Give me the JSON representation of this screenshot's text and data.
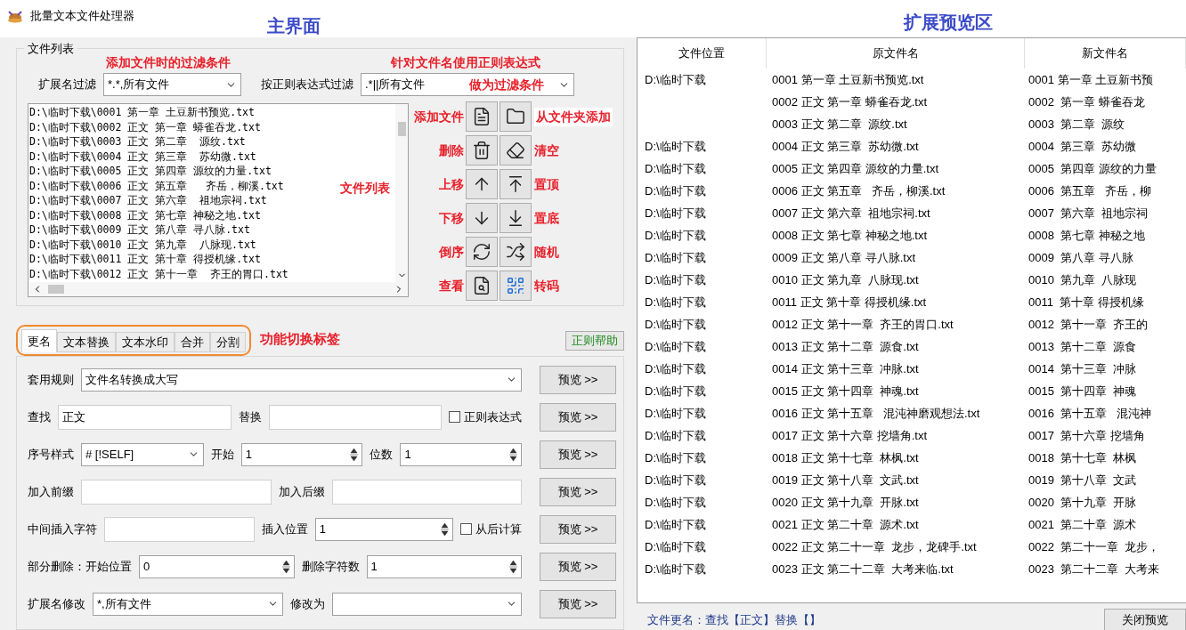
{
  "window": {
    "title": "批量文本文件处理器"
  },
  "annotations": {
    "main": "主界面",
    "preview": "扩展预览区",
    "ext_note": "添加文件时的过滤条件",
    "regex_note": "针对文件名使用正则表达式",
    "regex_note_2": "做为过滤条件",
    "list_note": "文件列表",
    "tabs_note": "功能切换标签"
  },
  "file_group": {
    "title": "文件列表",
    "ext_filter": {
      "label": "扩展名过滤",
      "value": "*.*,所有文件"
    },
    "regex_filter": {
      "label": "按正则表达式过滤",
      "value": ".*||所有文件"
    },
    "files": [
      "D:\\临时下载\\0001 第一章 土豆新书预览.txt",
      "D:\\临时下载\\0002 正文 第一章 蟒雀吞龙.txt",
      "D:\\临时下载\\0003 正文 第二章  源纹.txt",
      "D:\\临时下载\\0004 正文 第三章  苏幼微.txt",
      "D:\\临时下载\\0005 正文 第四章 源纹的力量.txt",
      "D:\\临时下载\\0006 正文 第五章   齐岳，柳溪.txt",
      "D:\\临时下载\\0007 正文 第六章  祖地宗祠.txt",
      "D:\\临时下载\\0008 正文 第七章 神秘之地.txt",
      "D:\\临时下载\\0009 正文 第八章 寻八脉.txt",
      "D:\\临时下载\\0010 正文 第九章  八脉现.txt",
      "D:\\临时下载\\0011 正文 第十章 得授机缘.txt",
      "D:\\临时下载\\0012 正文 第十一章  齐王的胃口.txt"
    ],
    "tool_rows": [
      {
        "left_note": "添加文件",
        "right_note": "从文件夹添加"
      },
      {
        "left_note": "删除",
        "right_note": "清空"
      },
      {
        "left_note": "上移",
        "right_note": "置顶"
      },
      {
        "left_note": "下移",
        "right_note": "置底"
      },
      {
        "left_note": "倒序",
        "right_note": "随机"
      },
      {
        "left_note": "查看",
        "right_note": "转码"
      }
    ]
  },
  "tabs": [
    {
      "label": "更名",
      "selected": true
    },
    {
      "label": "文本替换",
      "selected": false
    },
    {
      "label": "文本水印",
      "selected": false
    },
    {
      "label": "合并",
      "selected": false
    },
    {
      "label": "分割",
      "selected": false
    }
  ],
  "help_button": "正则帮助",
  "form_rows": [
    {
      "fields": [
        {
          "kind": "label",
          "text": "套用规则"
        },
        {
          "kind": "combo",
          "value": "文件名转换成大写"
        }
      ],
      "button": "预览 >>"
    },
    {
      "fields": [
        {
          "kind": "label",
          "text": "查找"
        },
        {
          "kind": "text",
          "value": "正文"
        },
        {
          "kind": "label",
          "text": "替换"
        },
        {
          "kind": "text"
        },
        {
          "kind": "check",
          "text": "正则表达式",
          "checked": false
        }
      ],
      "button": "预览 >>"
    },
    {
      "fields": [
        {
          "kind": "label",
          "text": "序号样式"
        },
        {
          "kind": "combo",
          "value": "# [!SELF]"
        },
        {
          "kind": "label",
          "text": "开始"
        },
        {
          "kind": "spin",
          "value": "1"
        },
        {
          "kind": "label",
          "text": "位数"
        },
        {
          "kind": "spin",
          "value": "1"
        }
      ],
      "button": "预览 >>"
    },
    {
      "fields": [
        {
          "kind": "label",
          "text": "加入前缀"
        },
        {
          "kind": "text"
        },
        {
          "kind": "label",
          "text": "加入后缀"
        },
        {
          "kind": "text"
        }
      ],
      "button": "预览 >>"
    },
    {
      "fields": [
        {
          "kind": "label",
          "text": "中间插入字符"
        },
        {
          "kind": "text"
        },
        {
          "kind": "label",
          "text": "插入位置"
        },
        {
          "kind": "spin",
          "value": "1"
        },
        {
          "kind": "check",
          "text": "从后计算",
          "checked": false
        }
      ],
      "button": "预览 >>"
    },
    {
      "fields": [
        {
          "kind": "label",
          "text": "部分删除：开始位置"
        },
        {
          "kind": "spin",
          "value": "0"
        },
        {
          "kind": "label",
          "text": "删除字符数"
        },
        {
          "kind": "spin",
          "value": "1"
        }
      ],
      "button": "预览 >>"
    },
    {
      "fields": [
        {
          "kind": "label",
          "text": "扩展名修改"
        },
        {
          "kind": "combo",
          "value": "*,所有文件"
        },
        {
          "kind": "label",
          "text": "修改为"
        },
        {
          "kind": "combo"
        }
      ],
      "button": "预览 >>"
    }
  ],
  "preview_table": {
    "columns": [
      "文件位置",
      "原文件名",
      "新文件名"
    ],
    "rows": [
      {
        "location": "D:\\临时下载",
        "original": "0001 第一章 土豆新书预览.txt",
        "new": "0001 第一章 土豆新书预"
      },
      {
        "original": "0002 正文 第一章 蟒雀吞龙.txt",
        "new": "0002  第一章 蟒雀吞龙"
      },
      {
        "original": "0003 正文 第二章  源纹.txt",
        "new": "0003  第二章  源纹"
      },
      {
        "location": "D:\\临时下载",
        "original": "0004 正文 第三章  苏幼微.txt",
        "new": "0004  第三章  苏幼微"
      },
      {
        "location": "D:\\临时下载",
        "original": "0005 正文 第四章 源纹的力量.txt",
        "new": "0005  第四章 源纹的力量"
      },
      {
        "location": "D:\\临时下载",
        "original": "0006 正文 第五章   齐岳，柳溪.txt",
        "new": "0006  第五章   齐岳，柳"
      },
      {
        "location": "D:\\临时下载",
        "original": "0007 正文 第六章  祖地宗祠.txt",
        "new": "0007  第六章  祖地宗祠"
      },
      {
        "location": "D:\\临时下载",
        "original": "0008 正文 第七章 神秘之地.txt",
        "new": "0008  第七章 神秘之地"
      },
      {
        "location": "D:\\临时下载",
        "original": "0009 正文 第八章 寻八脉.txt",
        "new": "0009  第八章 寻八脉"
      },
      {
        "location": "D:\\临时下载",
        "original": "0010 正文 第九章  八脉现.txt",
        "new": "0010  第九章  八脉现"
      },
      {
        "location": "D:\\临时下载",
        "original": "0011 正文 第十章 得授机缘.txt",
        "new": "0011  第十章 得授机缘"
      },
      {
        "location": "D:\\临时下载",
        "original": "0012 正文 第十一章  齐王的胃口.txt",
        "new": "0012  第十一章  齐王的"
      },
      {
        "location": "D:\\临时下载",
        "original": "0013 正文 第十二章  源食.txt",
        "new": "0013  第十二章  源食"
      },
      {
        "location": "D:\\临时下载",
        "original": "0014 正文 第十三章  冲脉.txt",
        "new": "0014  第十三章  冲脉"
      },
      {
        "location": "D:\\临时下载",
        "original": "0015 正文 第十四章  神魂.txt",
        "new": "0015  第十四章  神魂"
      },
      {
        "location": "D:\\临时下载",
        "original": "0016 正文 第十五章   混沌神磨观想法.txt",
        "new": "0016  第十五章   混沌神"
      },
      {
        "location": "D:\\临时下载",
        "original": "0017 正文 第十六章 挖墙角.txt",
        "new": "0017  第十六章 挖墙角"
      },
      {
        "location": "D:\\临时下载",
        "original": "0018 正文 第十七章  林枫.txt",
        "new": "0018  第十七章  林枫"
      },
      {
        "location": "D:\\临时下载",
        "original": "0019 正文 第十八章  文武.txt",
        "new": "0019  第十八章  文武"
      },
      {
        "location": "D:\\临时下载",
        "original": "0020 正文 第十九章  开脉.txt",
        "new": "0020  第十九章  开脉"
      },
      {
        "location": "D:\\临时下载",
        "original": "0021 正文 第二十章  源术.txt",
        "new": "0021  第二十章  源术"
      },
      {
        "location": "D:\\临时下载",
        "original": "0022 正文 第二十一章  龙步，龙碑手.txt",
        "new": "0022  第二十一章  龙步，"
      },
      {
        "location": "D:\\临时下载",
        "original": "0023 正文 第二十二章  大考来临.txt",
        "new": "0023  第二十二章  大考来"
      }
    ]
  },
  "status": "文件更名：查找【正文】替换【】",
  "close_button": "关闭预览"
}
